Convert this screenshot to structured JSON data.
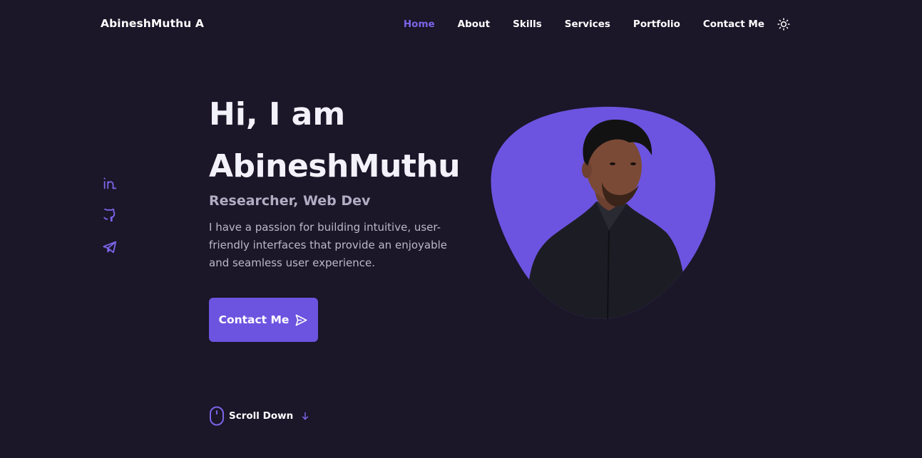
{
  "header": {
    "logo": "AbineshMuthu A",
    "nav": [
      "Home",
      "About",
      "Skills",
      "Services",
      "Portfolio",
      "Contact Me"
    ],
    "active_item": "Home",
    "theme_icon": "sun-icon"
  },
  "social": {
    "icons": [
      "linkedin-icon",
      "github-icon",
      "telegram-icon"
    ]
  },
  "hero": {
    "greeting": "Hi, I am",
    "name": "AbineshMuthu",
    "role": "Researcher, Web Dev",
    "description": "I have a passion for building intuitive, user-friendly interfaces that provide an enjoyable and seamless user experience.",
    "cta_label": "Contact Me",
    "cta_icon": "send-icon",
    "photo": "profile-photo"
  },
  "scroll": {
    "label": "Scroll Down",
    "icons": [
      "mouse-icon",
      "arrow-down-icon"
    ]
  },
  "colors": {
    "background": "#1b1628",
    "accent": "#6c54e0",
    "text": "#f3f1f9",
    "muted": "#b3adc3"
  }
}
